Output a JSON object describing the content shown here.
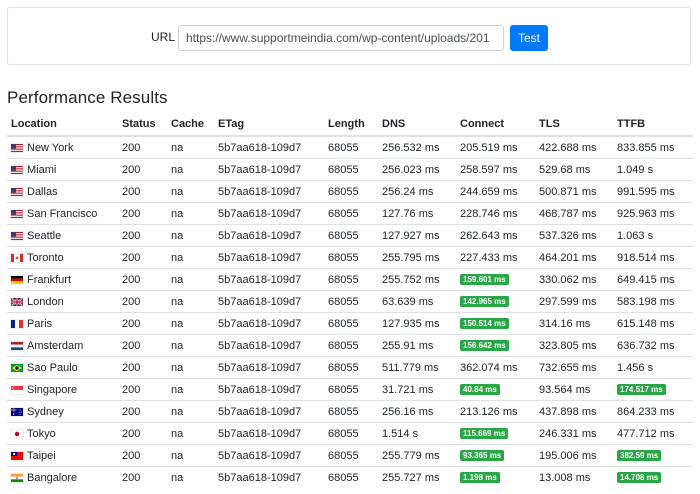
{
  "url_form": {
    "label": "URL",
    "value": "https://www.supportmeindia.com/wp-content/uploads/201",
    "button_label": "Test"
  },
  "title": "Performance Results",
  "columns": [
    "Location",
    "Status",
    "Cache",
    "ETag",
    "Length",
    "DNS",
    "Connect",
    "TLS",
    "TTFB"
  ],
  "rows": [
    {
      "location": "New York",
      "flag": "us-flag-icon",
      "status": "200",
      "cache": "na",
      "etag": "5b7aa618-109d7",
      "length": "68055",
      "dns": "256.532 ms",
      "connect": "205.519 ms",
      "connect_fast": false,
      "tls": "422.688 ms",
      "ttfb": "833.855 ms",
      "ttfb_fast": false
    },
    {
      "location": "Miami",
      "flag": "us-flag-icon",
      "status": "200",
      "cache": "na",
      "etag": "5b7aa618-109d7",
      "length": "68055",
      "dns": "256.023 ms",
      "connect": "258.597 ms",
      "connect_fast": false,
      "tls": "529.68 ms",
      "ttfb": "1.049 s",
      "ttfb_fast": false
    },
    {
      "location": "Dallas",
      "flag": "us-flag-icon",
      "status": "200",
      "cache": "na",
      "etag": "5b7aa618-109d7",
      "length": "68055",
      "dns": "256.24 ms",
      "connect": "244.659 ms",
      "connect_fast": false,
      "tls": "500.871 ms",
      "ttfb": "991.595 ms",
      "ttfb_fast": false
    },
    {
      "location": "San Francisco",
      "flag": "us-flag-icon",
      "status": "200",
      "cache": "na",
      "etag": "5b7aa618-109d7",
      "length": "68055",
      "dns": "127.76 ms",
      "connect": "228.746 ms",
      "connect_fast": false,
      "tls": "468.787 ms",
      "ttfb": "925.963 ms",
      "ttfb_fast": false
    },
    {
      "location": "Seattle",
      "flag": "us-flag-icon",
      "status": "200",
      "cache": "na",
      "etag": "5b7aa618-109d7",
      "length": "68055",
      "dns": "127.927 ms",
      "connect": "262.643 ms",
      "connect_fast": false,
      "tls": "537.326 ms",
      "ttfb": "1.063 s",
      "ttfb_fast": false
    },
    {
      "location": "Toronto",
      "flag": "ca-flag-icon",
      "status": "200",
      "cache": "na",
      "etag": "5b7aa618-109d7",
      "length": "68055",
      "dns": "255.795 ms",
      "connect": "227.433 ms",
      "connect_fast": false,
      "tls": "464.201 ms",
      "ttfb": "918.514 ms",
      "ttfb_fast": false
    },
    {
      "location": "Frankfurt",
      "flag": "de-flag-icon",
      "status": "200",
      "cache": "na",
      "etag": "5b7aa618-109d7",
      "length": "68055",
      "dns": "255.752 ms",
      "connect": "159.601 ms",
      "connect_fast": true,
      "tls": "330.062 ms",
      "ttfb": "649.415 ms",
      "ttfb_fast": false
    },
    {
      "location": "London",
      "flag": "gb-flag-icon",
      "status": "200",
      "cache": "na",
      "etag": "5b7aa618-109d7",
      "length": "68055",
      "dns": "63.639 ms",
      "connect": "142.965 ms",
      "connect_fast": true,
      "tls": "297.599 ms",
      "ttfb": "583.198 ms",
      "ttfb_fast": false
    },
    {
      "location": "Paris",
      "flag": "fr-flag-icon",
      "status": "200",
      "cache": "na",
      "etag": "5b7aa618-109d7",
      "length": "68055",
      "dns": "127.935 ms",
      "connect": "150.514 ms",
      "connect_fast": true,
      "tls": "314.16 ms",
      "ttfb": "615.148 ms",
      "ttfb_fast": false
    },
    {
      "location": "Amsterdam",
      "flag": "nl-flag-icon",
      "status": "200",
      "cache": "na",
      "etag": "5b7aa618-109d7",
      "length": "68055",
      "dns": "255.91 ms",
      "connect": "156.642 ms",
      "connect_fast": true,
      "tls": "323.805 ms",
      "ttfb": "636.732 ms",
      "ttfb_fast": false
    },
    {
      "location": "Sao Paulo",
      "flag": "br-flag-icon",
      "status": "200",
      "cache": "na",
      "etag": "5b7aa618-109d7",
      "length": "68055",
      "dns": "511.779 ms",
      "connect": "362.074 ms",
      "connect_fast": false,
      "tls": "732.655 ms",
      "ttfb": "1.456 s",
      "ttfb_fast": false
    },
    {
      "location": "Singapore",
      "flag": "sg-flag-icon",
      "status": "200",
      "cache": "na",
      "etag": "5b7aa618-109d7",
      "length": "68055",
      "dns": "31.721 ms",
      "connect": "40.84 ms",
      "connect_fast": true,
      "tls": "93.564 ms",
      "ttfb": "174.517 ms",
      "ttfb_fast": true
    },
    {
      "location": "Sydney",
      "flag": "au-flag-icon",
      "status": "200",
      "cache": "na",
      "etag": "5b7aa618-109d7",
      "length": "68055",
      "dns": "256.16 ms",
      "connect": "213.126 ms",
      "connect_fast": false,
      "tls": "437.898 ms",
      "ttfb": "864.233 ms",
      "ttfb_fast": false
    },
    {
      "location": "Tokyo",
      "flag": "jp-flag-icon",
      "status": "200",
      "cache": "na",
      "etag": "5b7aa618-109d7",
      "length": "68055",
      "dns": "1.514 s",
      "connect": "115.669 ms",
      "connect_fast": true,
      "tls": "246.331 ms",
      "ttfb": "477.712 ms",
      "ttfb_fast": false
    },
    {
      "location": "Taipei",
      "flag": "tw-flag-icon",
      "status": "200",
      "cache": "na",
      "etag": "5b7aa618-109d7",
      "length": "68055",
      "dns": "255.779 ms",
      "connect": "93.365 ms",
      "connect_fast": true,
      "tls": "195.006 ms",
      "ttfb": "382.59 ms",
      "ttfb_fast": true
    },
    {
      "location": "Bangalore",
      "flag": "in-flag-icon",
      "status": "200",
      "cache": "na",
      "etag": "5b7aa618-109d7",
      "length": "68055",
      "dns": "255.727 ms",
      "connect": "1.198 ms",
      "connect_fast": true,
      "tls": "13.008 ms",
      "ttfb": "14.708 ms",
      "ttfb_fast": true
    }
  ],
  "colors": {
    "primary_button": "#007bff",
    "fast_badge": "#28a745",
    "border": "#dee2e6"
  }
}
